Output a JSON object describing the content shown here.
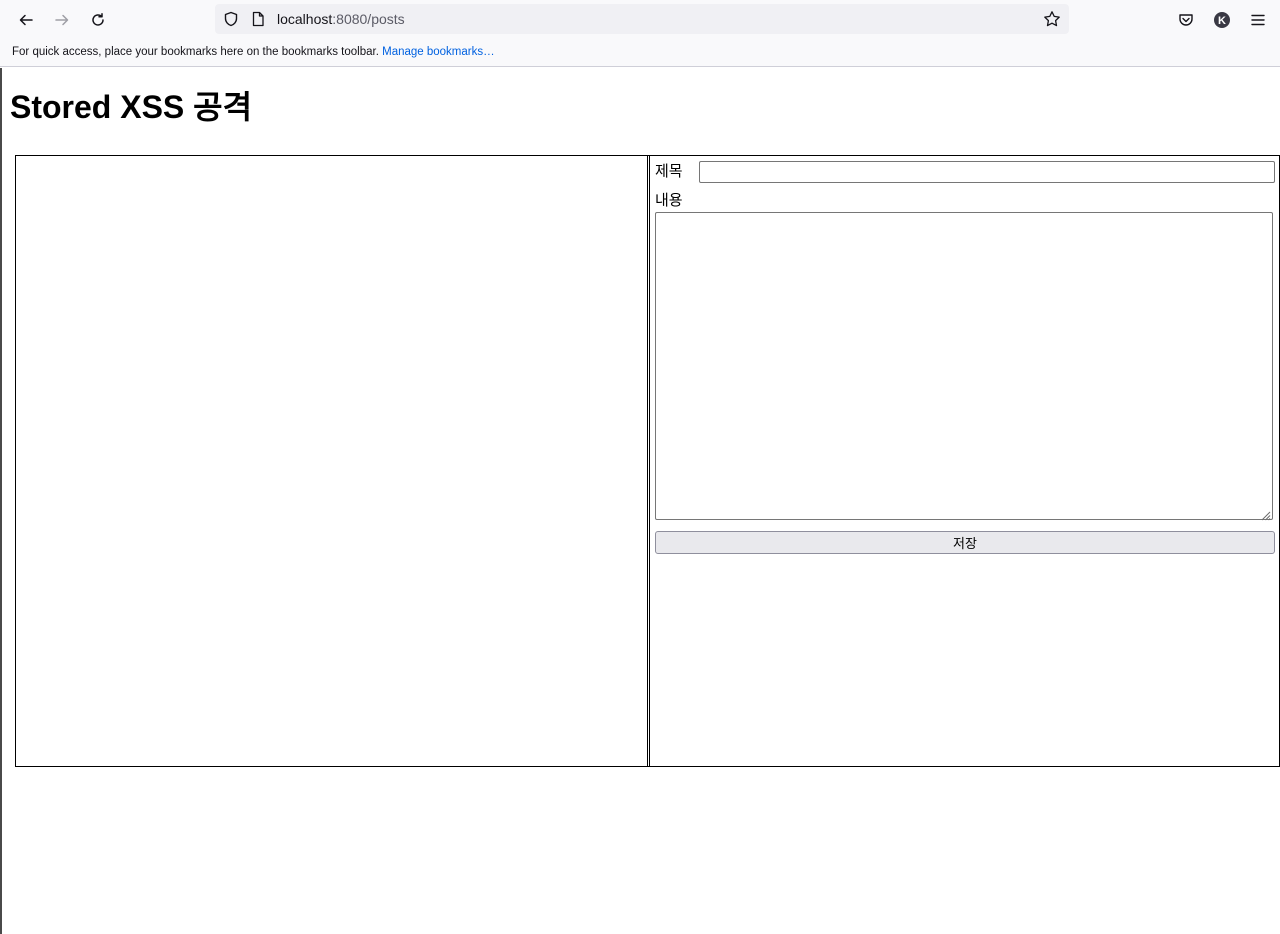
{
  "browser": {
    "url_host": "localhost",
    "url_rest": ":8080/posts",
    "bookmarks_prompt": "For quick access, place your bookmarks here on the bookmarks toolbar.",
    "manage_bookmarks": "Manage bookmarks…",
    "account_initial": "K",
    "icons": [
      "back-arrow-icon",
      "forward-arrow-icon",
      "reload-icon",
      "shield-icon",
      "page-icon",
      "star-icon",
      "pocket-icon",
      "account-icon",
      "hamburger-menu-icon"
    ]
  },
  "page": {
    "title": "Stored XSS 공격",
    "form": {
      "title_label": "제목",
      "title_value": "",
      "content_label": "내용",
      "content_value": "",
      "save_label": "저장"
    }
  }
}
